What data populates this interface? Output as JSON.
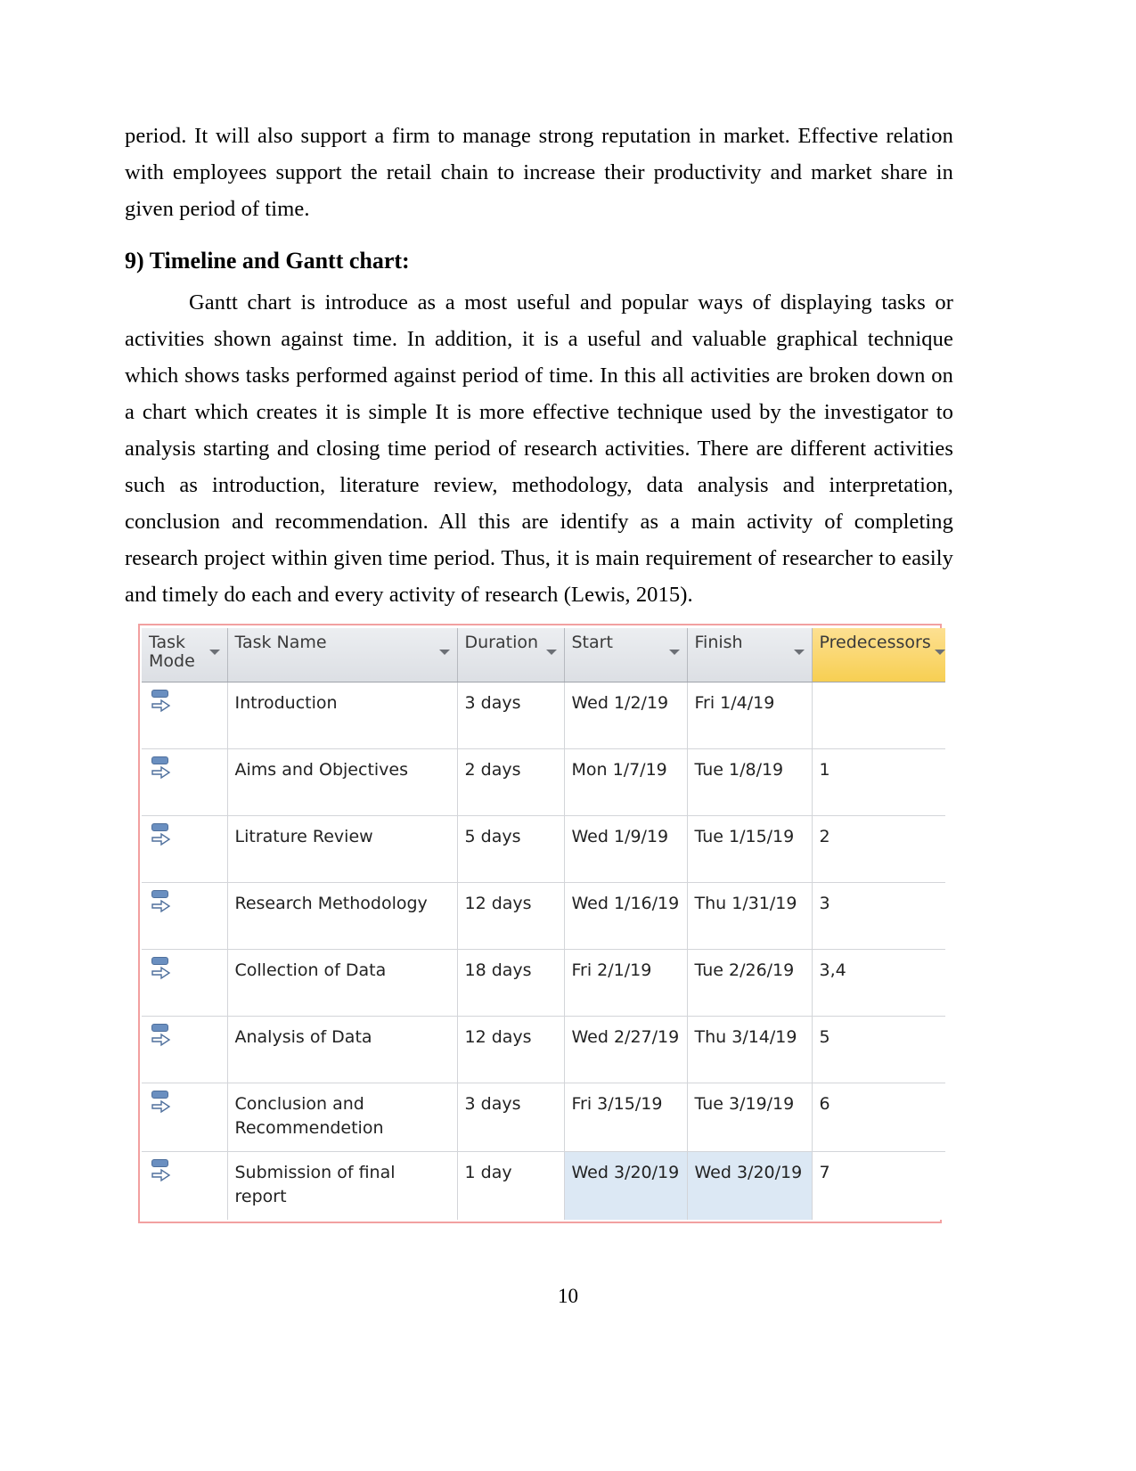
{
  "document": {
    "paragraph_before": "period. It will also support a firm to manage strong reputation in market. Effective relation with employees support the retail chain to increase their productivity and market share in given period of time.",
    "section_heading": "9) Timeline and Gantt chart:",
    "paragraph_body": "Gantt chart is introduce as a most useful and popular ways of displaying tasks or activities shown against time. In addition, it is a useful and valuable graphical technique which shows tasks performed against period of time. In this all activities are broken down on a chart which creates it is simple It is more effective technique used by the investigator to analysis starting and closing time period of research activities. There are different activities such as introduction, literature review, methodology, data analysis and interpretation, conclusion and recommendation. All this are identify as a main activity of completing research project within given time period. Thus, it is main requirement of researcher to easily and timely do each and every activity of research (Lewis, 2015).",
    "page_number": "10"
  },
  "gantt_table": {
    "columns": [
      {
        "key": "task_mode",
        "label": "Task\nMode",
        "has_filter": true,
        "highlighted": false
      },
      {
        "key": "task_name",
        "label": "Task Name",
        "has_filter": true,
        "highlighted": false
      },
      {
        "key": "duration",
        "label": "Duration",
        "has_filter": true,
        "highlighted": false
      },
      {
        "key": "start",
        "label": "Start",
        "has_filter": true,
        "highlighted": false
      },
      {
        "key": "finish",
        "label": "Finish",
        "has_filter": true,
        "highlighted": false
      },
      {
        "key": "predecessors",
        "label": "Predecessors",
        "has_filter": true,
        "highlighted": true
      }
    ],
    "rows": [
      {
        "task_mode_icon": "auto-schedule-icon",
        "task_name": "Introduction",
        "duration": "3 days",
        "start": "Wed 1/2/19",
        "finish": "Fri 1/4/19",
        "predecessors": "",
        "selected": false
      },
      {
        "task_mode_icon": "auto-schedule-icon",
        "task_name": "Aims and Objectives",
        "duration": "2 days",
        "start": "Mon 1/7/19",
        "finish": "Tue 1/8/19",
        "predecessors": "1",
        "selected": false
      },
      {
        "task_mode_icon": "auto-schedule-icon",
        "task_name": "Litrature Review",
        "duration": "5 days",
        "start": "Wed 1/9/19",
        "finish": "Tue 1/15/19",
        "predecessors": "2",
        "selected": false
      },
      {
        "task_mode_icon": "auto-schedule-icon",
        "task_name": "Research Methodology",
        "duration": "12 days",
        "start": "Wed 1/16/19",
        "finish": "Thu 1/31/19",
        "predecessors": "3",
        "selected": false
      },
      {
        "task_mode_icon": "auto-schedule-icon",
        "task_name": "Collection of Data",
        "duration": "18 days",
        "start": "Fri 2/1/19",
        "finish": "Tue 2/26/19",
        "predecessors": "3,4",
        "selected": false
      },
      {
        "task_mode_icon": "auto-schedule-icon",
        "task_name": "Analysis of Data",
        "duration": "12 days",
        "start": "Wed 2/27/19",
        "finish": "Thu 3/14/19",
        "predecessors": "5",
        "selected": false
      },
      {
        "task_mode_icon": "auto-schedule-icon",
        "task_name": "Conclusion and Recommendetion",
        "duration": "3 days",
        "start": "Fri 3/15/19",
        "finish": "Tue 3/19/19",
        "predecessors": "6",
        "selected": false
      },
      {
        "task_mode_icon": "auto-schedule-icon",
        "task_name": "Submission of final report",
        "duration": "1 day",
        "start": "Wed 3/20/19",
        "finish": "Wed 3/20/19",
        "predecessors": "7",
        "selected": true
      }
    ],
    "colors": {
      "header_background": "#e2e4e8",
      "predecessors_header_background": "#fcd96a",
      "selection_background": "#dce8f4",
      "border": "#f2a0a0",
      "grid_line": "#d3d5d9",
      "task_mode_icon": "#6a8fc0"
    }
  }
}
